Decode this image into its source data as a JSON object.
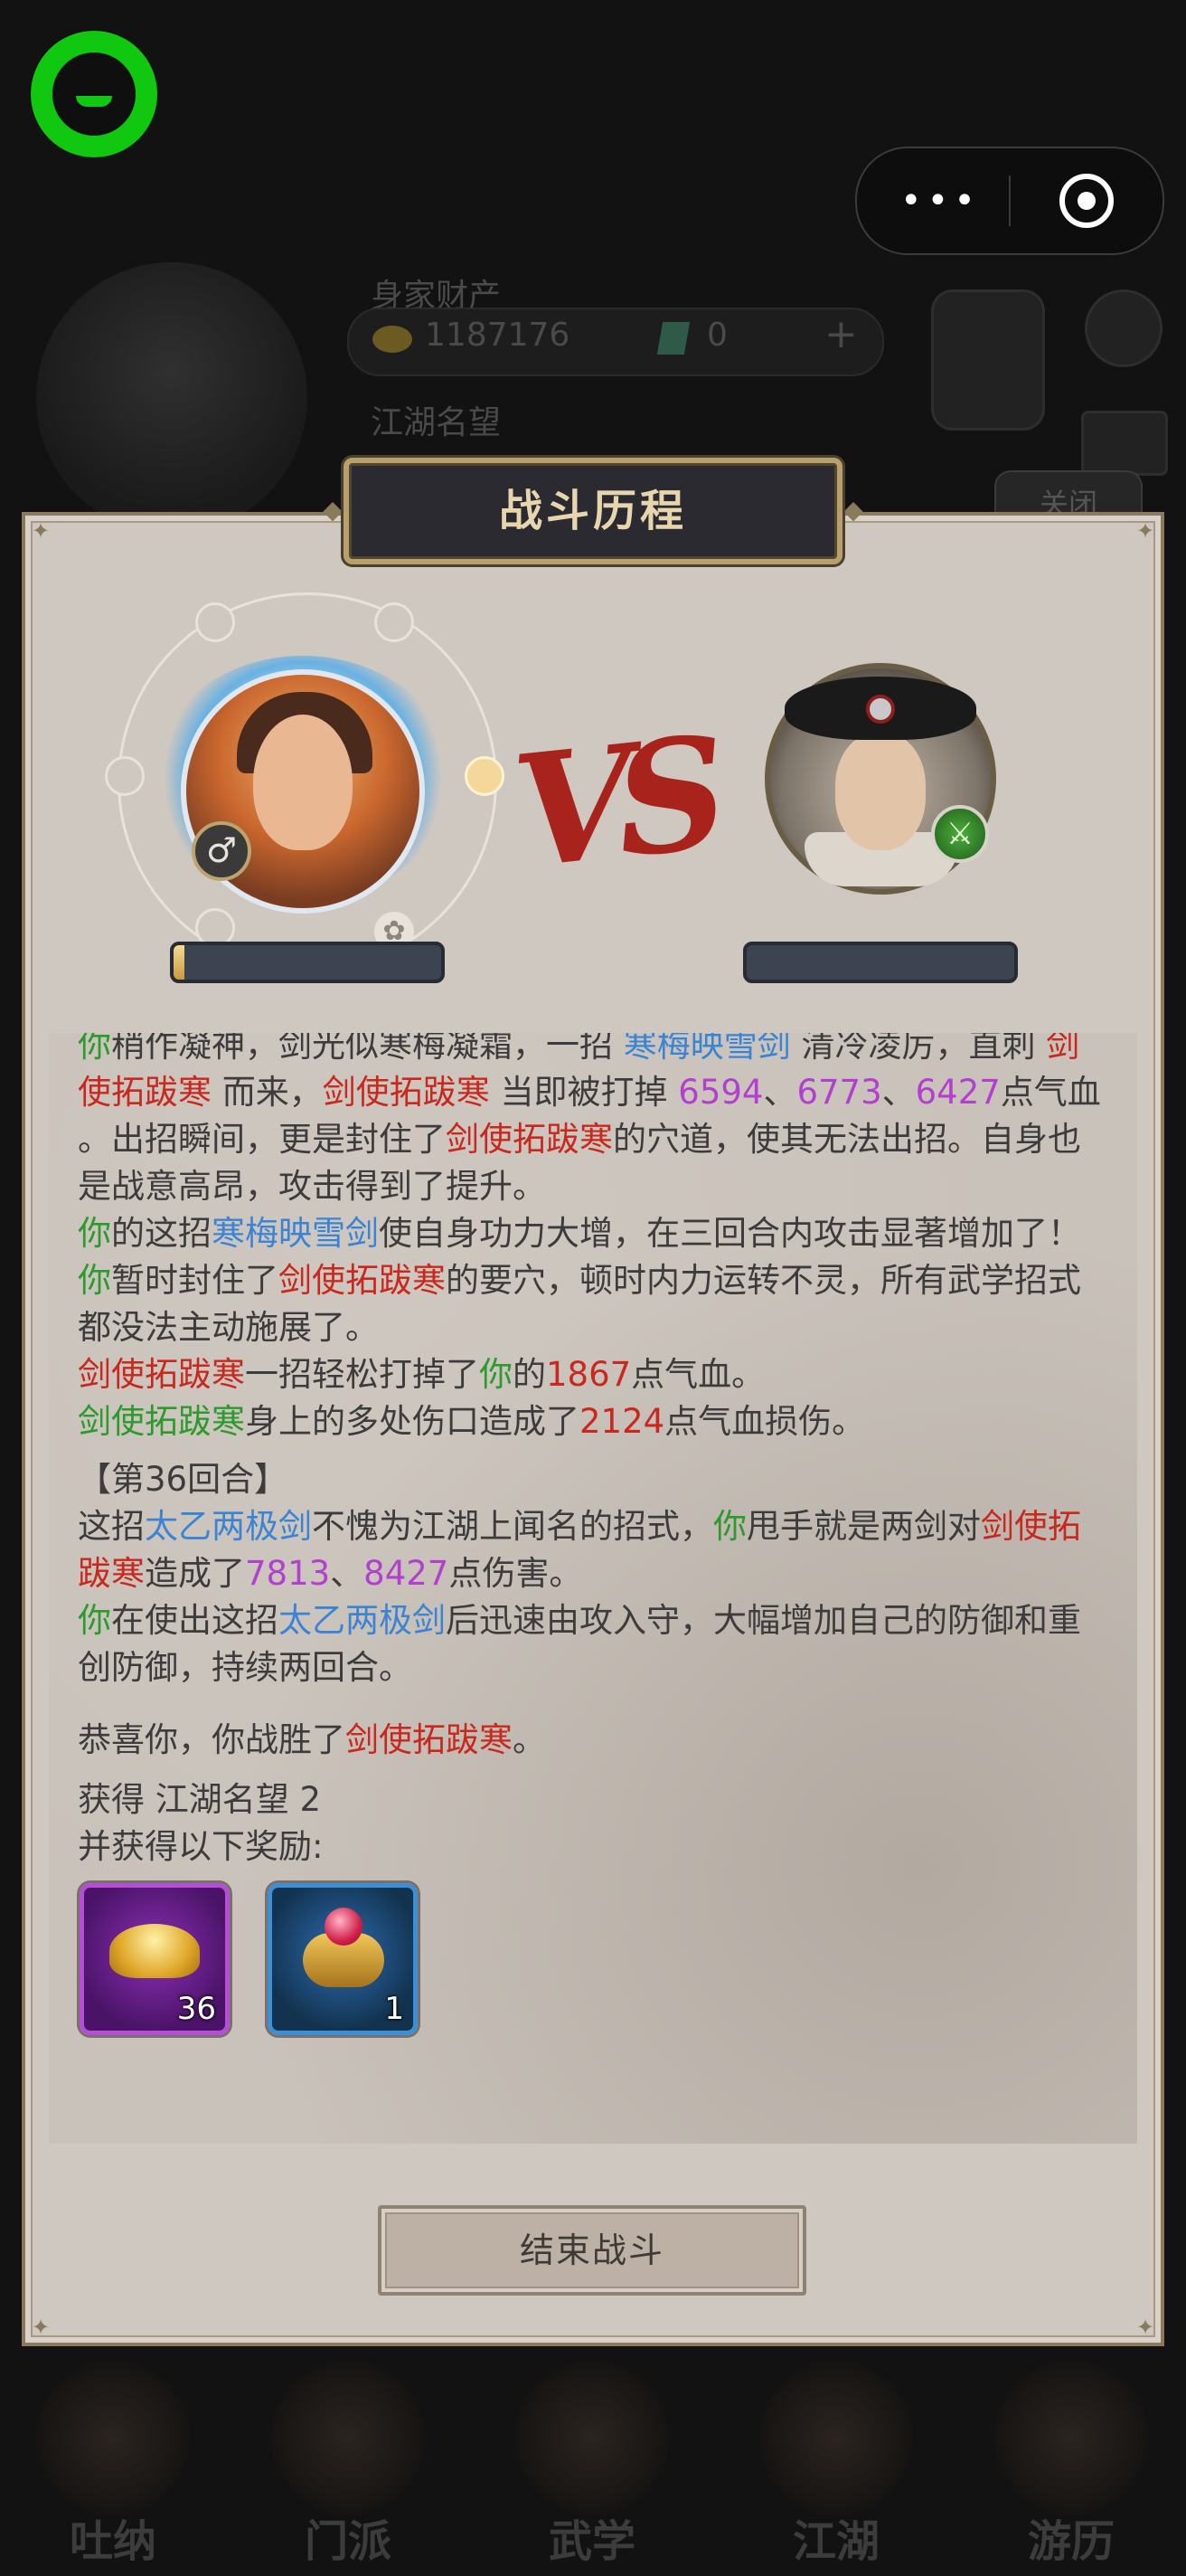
{
  "background": {
    "assets_label": "身家财产",
    "gold_amount": "1187176",
    "jade_amount": "0",
    "reputation_label": "江湖名望",
    "close_label": "关闭",
    "bottom_nav": [
      "吐纳",
      "门派",
      "武学",
      "江湖",
      "游历"
    ]
  },
  "dialog": {
    "title": "战斗历程",
    "vs_text": "VS",
    "player_gender_symbol": "♂",
    "player_hp_fraction": 0.04,
    "enemy_hp_fraction": 0.0
  },
  "log": {
    "l1": {
      "a": "你",
      "b": "稍作凝神，剑光似寒梅凝霜，一招 ",
      "c": "寒梅映雪剑",
      "d": " 清冷凌厉，直刺 ",
      "e": "剑"
    },
    "l2": {
      "a": "使拓跋寒",
      "b": " 而来，",
      "c": "剑使拓跋寒",
      "d": " 当即被打掉 ",
      "e": "6594",
      "f": "、",
      "g": "6773",
      "h": "、",
      "i": "6427",
      "j": "点气血"
    },
    "l3": {
      "a": "。出招瞬间，更是封住了",
      "b": "剑使拓跋寒",
      "c": "的穴道，使其无法出招。自身也"
    },
    "l4": {
      "a": "是战意高昂，攻击得到了提升。"
    },
    "l5": {
      "a": "你",
      "b": "的这招",
      "c": "寒梅映雪剑",
      "d": "使自身功力大增，在三回合内攻击显著增加了！"
    },
    "l6": {
      "a": "你",
      "b": "暂时封住了",
      "c": "剑使拓跋寒",
      "d": "的要穴，顿时内力运转不灵，所有武学招式"
    },
    "l7": {
      "a": "都没法主动施展了。"
    },
    "l8": {
      "a": "剑使拓跋寒",
      "b": "一招轻松打掉了",
      "c": "你",
      "d": "的",
      "e": "1867",
      "f": "点气血。"
    },
    "l9": {
      "a": "剑使拓跋寒",
      "b": "身上的多处伤口造成了",
      "c": "2124",
      "d": "点气血损伤。"
    },
    "l10": {
      "a": "【第36回合】"
    },
    "l11": {
      "a": "这招",
      "b": "太乙两极剑",
      "c": "不愧为江湖上闻名的招式，",
      "d": "你",
      "e": "甩手就是两剑对",
      "f": "剑使拓"
    },
    "l12": {
      "a": "跋寒",
      "b": "造成了",
      "c": "7813",
      "d": "、",
      "e": "8427",
      "f": "点伤害。"
    },
    "l13": {
      "a": "你",
      "b": "在使出这招",
      "c": "太乙两极剑",
      "d": "后迅速由攻入守，大幅增加自己的防御和重"
    },
    "l14": {
      "a": "创防御，持续两回合。"
    },
    "l15": {
      "a": "恭喜你，你战胜了",
      "b": "剑使拓跋寒",
      "c": "。"
    },
    "l16": {
      "a": "获得 江湖名望 2"
    },
    "l17": {
      "a": "并获得以下奖励:"
    }
  },
  "rewards": [
    {
      "icon": "gold-ingot-icon",
      "count": "36",
      "rarity_color": "#b34fd6"
    },
    {
      "icon": "ruby-ring-icon",
      "count": "1",
      "rarity_color": "#3b8fd6"
    }
  ],
  "end_button_label": "结束战斗",
  "colors": {
    "player_name": "#2c9a2c",
    "enemy_name": "#c8281e",
    "skill_name": "#3b84d4",
    "damage_value": "#b33fcf",
    "enemy_damage": "#c8281e"
  }
}
